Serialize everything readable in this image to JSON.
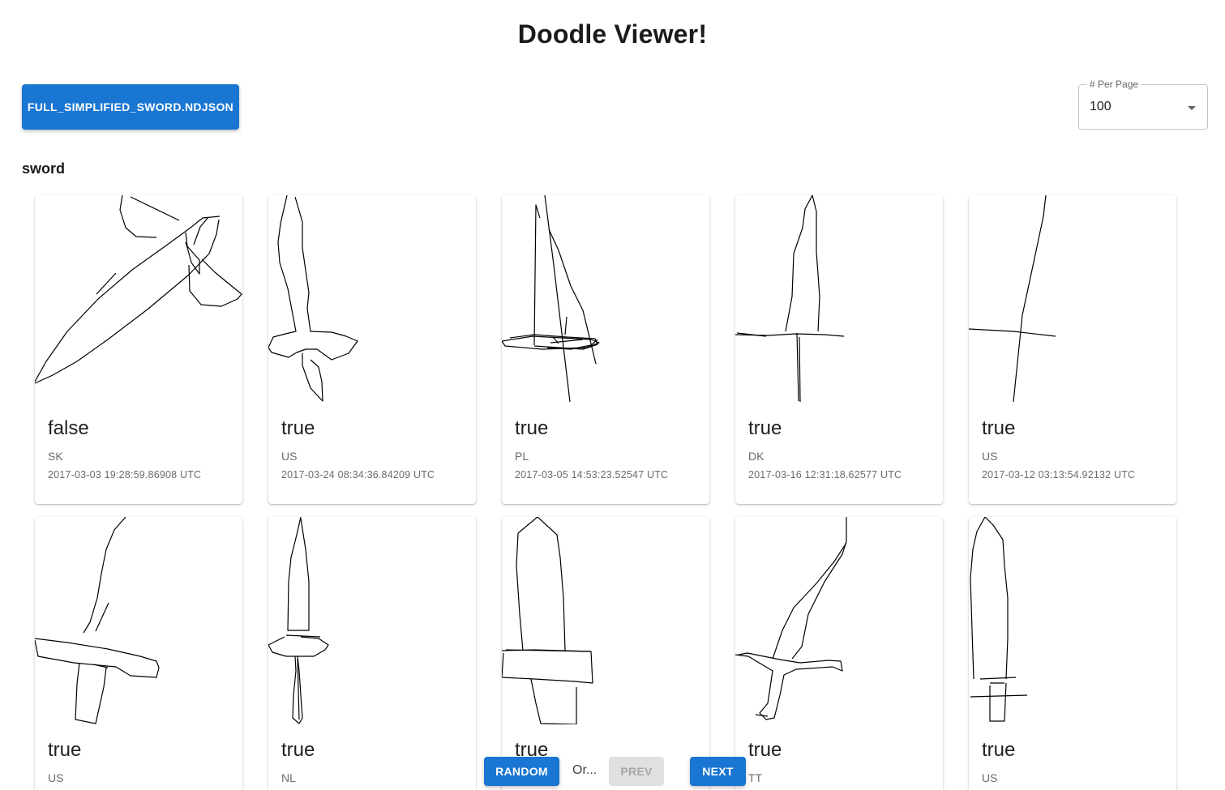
{
  "header": {
    "title": "Doodle Viewer!"
  },
  "toolbar": {
    "file_button_label": "FULL_SIMPLIFIED_SWORD.NDJSON"
  },
  "per_page": {
    "label": "# Per Page",
    "value": "100"
  },
  "category": "sword",
  "cards": [
    {
      "recognized": "false",
      "country": "SK",
      "timestamp": "2017-03-03 19:28:59.86908 UTC"
    },
    {
      "recognized": "true",
      "country": "US",
      "timestamp": "2017-03-24 08:34:36.84209 UTC"
    },
    {
      "recognized": "true",
      "country": "PL",
      "timestamp": "2017-03-05 14:53:23.52547 UTC"
    },
    {
      "recognized": "true",
      "country": "DK",
      "timestamp": "2017-03-16 12:31:18.62577 UTC"
    },
    {
      "recognized": "true",
      "country": "US",
      "timestamp": "2017-03-12 03:13:54.92132 UTC"
    },
    {
      "recognized": "true",
      "country": "US",
      "timestamp": ""
    },
    {
      "recognized": "true",
      "country": "NL",
      "timestamp": ""
    },
    {
      "recognized": "true",
      "country": "",
      "timestamp": ""
    },
    {
      "recognized": "true",
      "country": "TT",
      "timestamp": ""
    },
    {
      "recognized": "true",
      "country": "US",
      "timestamp": ""
    }
  ],
  "pagination": {
    "random_label": "RANDOM",
    "or_text": "Or...",
    "prev_label": "PREV",
    "next_label": "NEXT"
  },
  "colors": {
    "primary": "#1976d2",
    "disabled_bg": "#e0e0e0",
    "disabled_text": "#a6a6a6"
  }
}
